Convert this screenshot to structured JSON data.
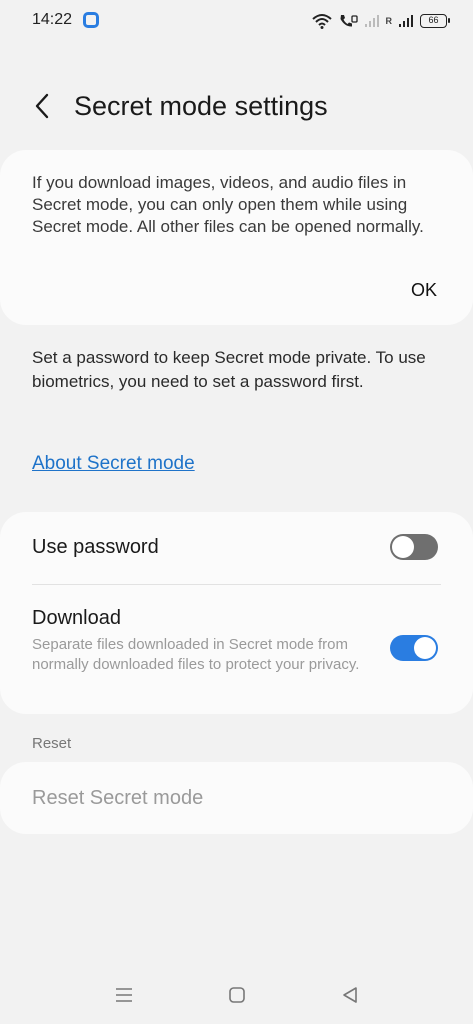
{
  "status_bar": {
    "time": "14:22",
    "battery": "66",
    "signal_roaming": "R",
    "icons": [
      "app-notification-icon",
      "wifi-icon",
      "volte-call-icon",
      "signal-icon",
      "signal-roaming-icon",
      "battery-icon"
    ]
  },
  "header": {
    "back_icon": "chevron-left-icon",
    "title": "Secret mode settings"
  },
  "info_card": {
    "text": "If you download images, videos, and audio files in Secret mode, you can only open them while using Secret mode. All other files can be opened normally.",
    "ok_label": "OK"
  },
  "description": "Set a password to keep Secret mode private. To use biometrics, you need to set a password first.",
  "about_link": "About Secret mode",
  "settings": {
    "use_password": {
      "label": "Use password",
      "enabled": false
    },
    "download": {
      "label": "Download",
      "sublabel": "Separate files downloaded in Secret mode from normally downloaded files to protect your privacy.",
      "enabled": true
    }
  },
  "reset_section": {
    "header": "Reset",
    "item_label": "Reset Secret mode"
  },
  "colors": {
    "accent": "#2a7de1",
    "link": "#1f73c9",
    "background": "#f2f2f2",
    "card": "#fbfbfb"
  },
  "nav_bar": {
    "icons": [
      "menu-icon",
      "home-icon",
      "back-icon"
    ]
  }
}
